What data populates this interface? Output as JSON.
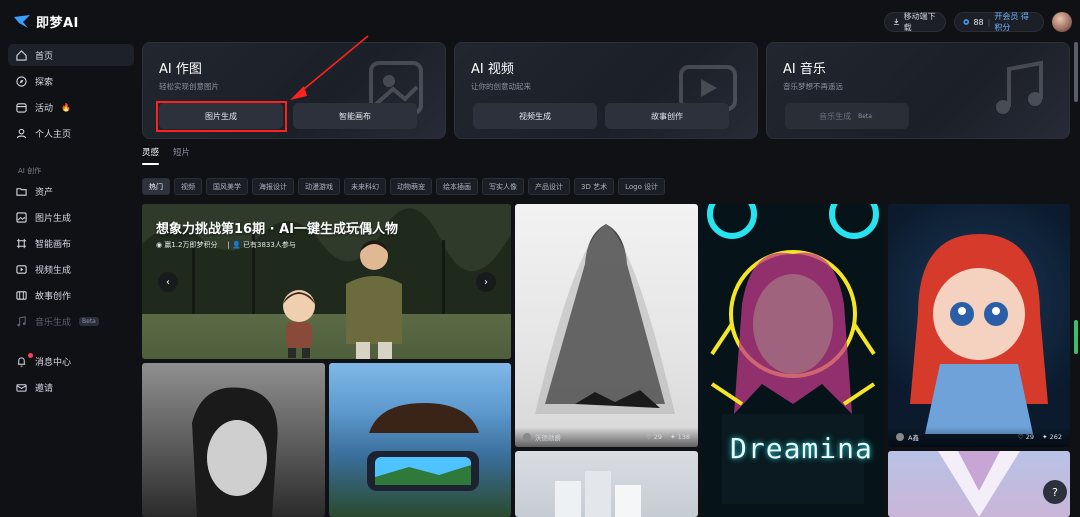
{
  "app": {
    "logo_text": "即梦AI"
  },
  "topbar": {
    "download_label": "移动端下载",
    "credits": "88",
    "vip_label": "开会员 得积分"
  },
  "sidebar": {
    "items": [
      {
        "label": "首页",
        "icon": "home-icon"
      },
      {
        "label": "探索",
        "icon": "compass-icon"
      },
      {
        "label": "活动",
        "icon": "activity-icon"
      },
      {
        "label": "个人主页",
        "icon": "user-icon"
      }
    ],
    "section_label": "AI 创作",
    "create_items": [
      {
        "label": "资产",
        "icon": "folder-icon"
      },
      {
        "label": "图片生成",
        "icon": "image-icon"
      },
      {
        "label": "智能画布",
        "icon": "canvas-icon"
      },
      {
        "label": "视频生成",
        "icon": "video-icon"
      },
      {
        "label": "故事创作",
        "icon": "story-icon"
      },
      {
        "label": "音乐生成",
        "icon": "music-icon",
        "badge": "Beta"
      }
    ],
    "footer_items": [
      {
        "label": "消息中心",
        "icon": "bell-icon"
      },
      {
        "label": "邀请",
        "icon": "invite-icon"
      }
    ]
  },
  "cards": [
    {
      "title": "AI 作图",
      "subtitle": "轻松实现创意图片",
      "buttons": [
        "图片生成",
        "智能画布"
      ]
    },
    {
      "title": "AI 视频",
      "subtitle": "让你的创意动起来",
      "buttons": [
        "视频生成",
        "故事创作"
      ]
    },
    {
      "title": "AI 音乐",
      "subtitle": "音乐梦想不再遥远",
      "buttons": [
        "音乐生成"
      ],
      "badge": "Beta"
    }
  ],
  "tabs": [
    "灵感",
    "短片"
  ],
  "chips": [
    "热门",
    "视频",
    "国风美学",
    "海报设计",
    "动漫游戏",
    "未来科幻",
    "动物萌宠",
    "绘本插画",
    "写实人像",
    "产品设计",
    "3D 艺术",
    "Logo 设计"
  ],
  "banner": {
    "title": "想象力挑战第16期 · AI一键生成玩偶人物",
    "reward": "赢1.2万即梦积分",
    "participants": "已有3833人参与"
  },
  "tiles": {
    "veil": {
      "author": "沃德勋爵",
      "likes": "29",
      "remixes": "138"
    },
    "neon": {
      "text": "Dreamina"
    },
    "red": {
      "author": "A鑫",
      "likes": "29",
      "remixes": "262"
    }
  },
  "colors": {
    "background": "#0f1115",
    "accent": "#6fb3ff",
    "highlight": "#ff2020"
  }
}
